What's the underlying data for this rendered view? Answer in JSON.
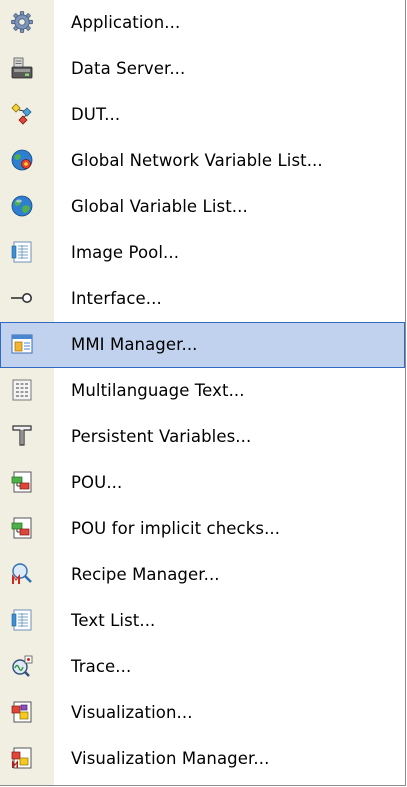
{
  "menu": {
    "items": [
      {
        "label": "Application...",
        "icon": "gear-icon"
      },
      {
        "label": "Data Server...",
        "icon": "data-server-icon"
      },
      {
        "label": "DUT...",
        "icon": "dut-icon"
      },
      {
        "label": "Global Network Variable List...",
        "icon": "globe-network-icon"
      },
      {
        "label": "Global Variable List...",
        "icon": "globe-icon"
      },
      {
        "label": "Image Pool...",
        "icon": "image-pool-icon"
      },
      {
        "label": "Interface...",
        "icon": "interface-icon"
      },
      {
        "label": "MMI Manager...",
        "icon": "mmi-manager-icon",
        "highlighted": true
      },
      {
        "label": "Multilanguage Text...",
        "icon": "multilanguage-text-icon"
      },
      {
        "label": "Persistent Variables...",
        "icon": "persistent-variables-icon"
      },
      {
        "label": "POU...",
        "icon": "pou-icon"
      },
      {
        "label": "POU for implicit checks...",
        "icon": "pou-implicit-checks-icon"
      },
      {
        "label": "Recipe Manager...",
        "icon": "recipe-manager-icon"
      },
      {
        "label": "Text List...",
        "icon": "text-list-icon"
      },
      {
        "label": "Trace...",
        "icon": "trace-icon"
      },
      {
        "label": "Visualization...",
        "icon": "visualization-icon"
      },
      {
        "label": "Visualization Manager...",
        "icon": "visualization-manager-icon"
      }
    ]
  },
  "colors": {
    "gutter": "#f1efe2",
    "highlight_fill": "#c1d2ee",
    "highlight_border": "#316ac5"
  }
}
